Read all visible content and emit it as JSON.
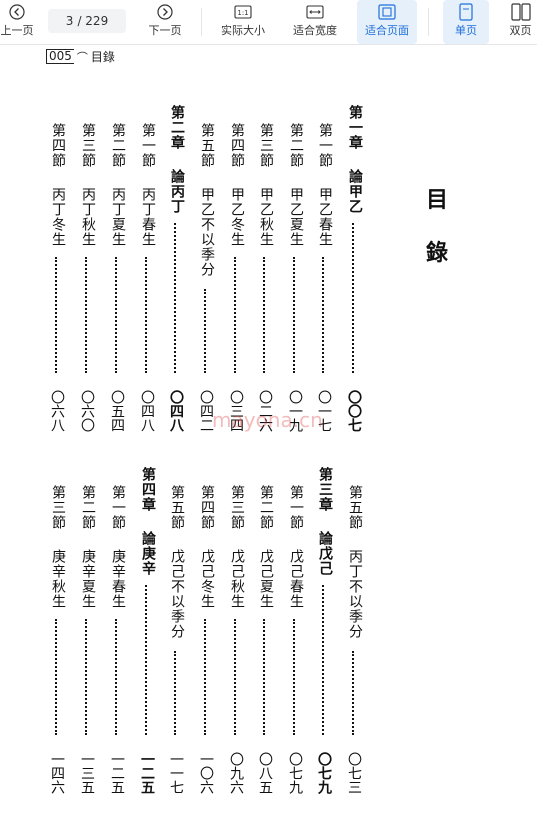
{
  "toolbar": {
    "prev_label": "上一页",
    "page_current": "3",
    "page_total": "/ 229",
    "next_label": "下一页",
    "actual_size_label": "实际大小",
    "fit_width_label": "适合宽度",
    "fit_page_label": "适合页面",
    "single_page_label": "单页",
    "double_page_label": "双页"
  },
  "header": {
    "page_number": "005",
    "title": "目錄"
  },
  "title": {
    "char1": "目",
    "char2": "錄"
  },
  "watermark": "mayona.cn",
  "toc_top": [
    {
      "section": "第一章",
      "topic": "論甲乙",
      "page": "〇〇七",
      "chapter": true
    },
    {
      "section": "第一節",
      "topic": "甲乙春生",
      "page": "〇一七"
    },
    {
      "section": "第二節",
      "topic": "甲乙夏生",
      "page": "〇一九"
    },
    {
      "section": "第三節",
      "topic": "甲乙秋生",
      "page": "〇二六"
    },
    {
      "section": "第四節",
      "topic": "甲乙冬生",
      "page": "〇三四"
    },
    {
      "section": "第五節",
      "topic": "甲乙不以季分",
      "page": "〇四二"
    },
    {
      "section": "第二章",
      "topic": "論丙丁",
      "page": "〇四八",
      "chapter": true
    },
    {
      "section": "第一節",
      "topic": "丙丁春生",
      "page": "〇四八"
    },
    {
      "section": "第二節",
      "topic": "丙丁夏生",
      "page": "〇五四"
    },
    {
      "section": "第三節",
      "topic": "丙丁秋生",
      "page": "〇六〇"
    },
    {
      "section": "第四節",
      "topic": "丙丁冬生",
      "page": "〇六八"
    }
  ],
  "toc_bottom": [
    {
      "section": "第五節",
      "topic": "丙丁不以季分",
      "page": "〇七三"
    },
    {
      "section": "第三章",
      "topic": "論戊己",
      "page": "〇七九",
      "chapter": true
    },
    {
      "section": "第一節",
      "topic": "戊己春生",
      "page": "〇七九"
    },
    {
      "section": "第二節",
      "topic": "戊己夏生",
      "page": "〇八五"
    },
    {
      "section": "第三節",
      "topic": "戊己秋生",
      "page": "〇九六"
    },
    {
      "section": "第四節",
      "topic": "戊己冬生",
      "page": "一〇六"
    },
    {
      "section": "第五節",
      "topic": "戊己不以季分",
      "page": "一一七"
    },
    {
      "section": "第四章",
      "topic": "論庚辛",
      "page": "一二五",
      "chapter": true
    },
    {
      "section": "第一節",
      "topic": "庚辛春生",
      "page": "一二五"
    },
    {
      "section": "第二節",
      "topic": "庚辛夏生",
      "page": "一三五"
    },
    {
      "section": "第三節",
      "topic": "庚辛秋生",
      "page": "一四六"
    }
  ]
}
